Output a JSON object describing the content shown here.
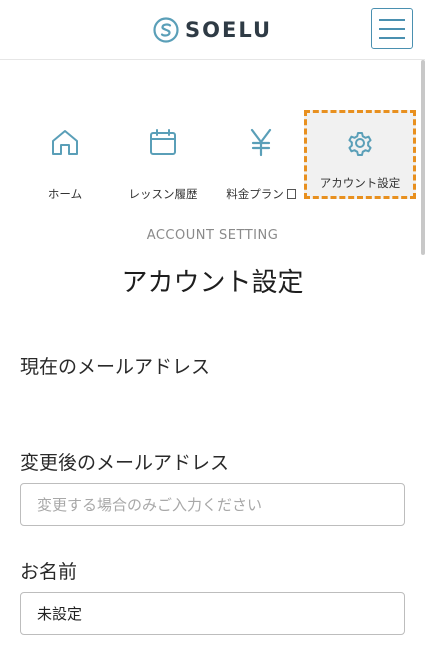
{
  "header": {
    "logo_text": "SOELU",
    "logo_icon": "soelu-logo-icon",
    "menu_icon": "hamburger-menu-icon"
  },
  "nav": {
    "items": [
      {
        "label": "ホーム",
        "icon": "home-icon",
        "active": false
      },
      {
        "label": "レッスン履歴",
        "icon": "calendar-icon",
        "active": false
      },
      {
        "label": "料金プラン",
        "icon": "yen-icon",
        "active": false
      },
      {
        "label": "アカウント設定",
        "icon": "gear-icon",
        "active": true
      }
    ]
  },
  "section": {
    "subtitle": "ACCOUNT SETTING",
    "title": "アカウント設定"
  },
  "form": {
    "current_email_label": "現在のメールアドレス",
    "new_email_label": "変更後のメールアドレス",
    "new_email_placeholder": "変更する場合のみご入力ください",
    "new_email_value": "",
    "name_label": "お名前",
    "name_value": "未設定"
  },
  "colors": {
    "accent": "#4a90b0",
    "highlight_border": "#e8901f",
    "icon": "#5a9fb8"
  }
}
